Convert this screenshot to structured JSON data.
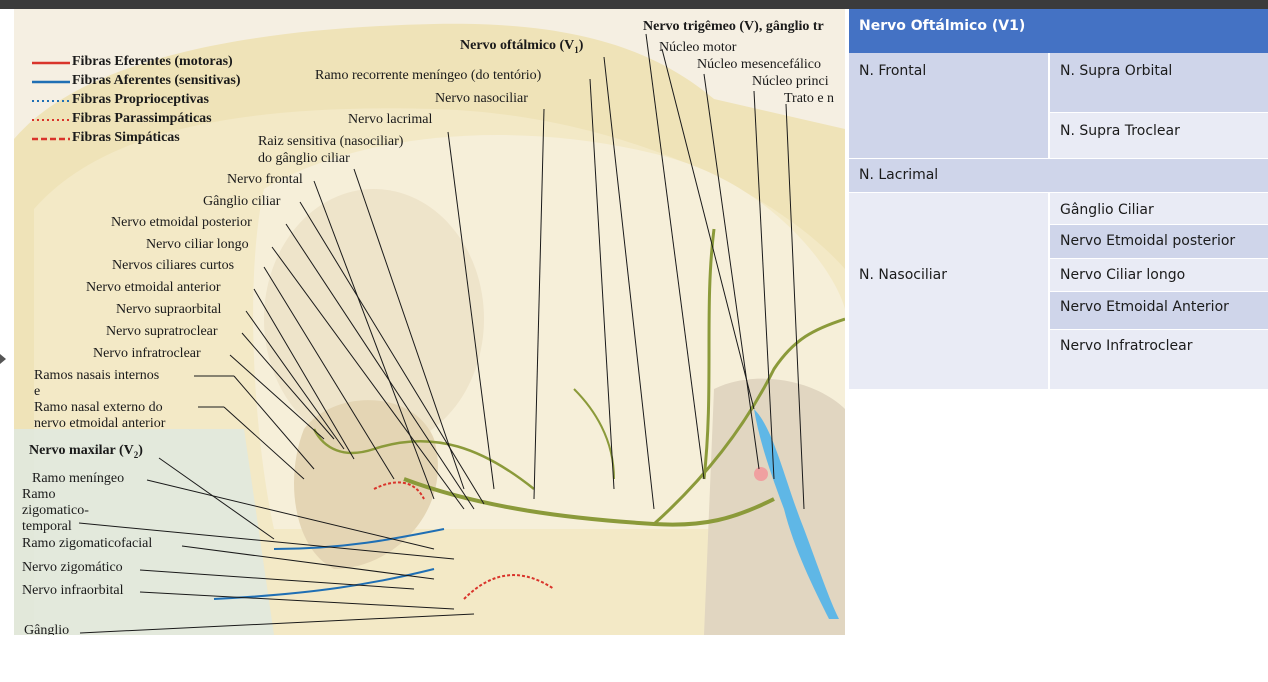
{
  "legend": [
    {
      "label": "Fibras Eferentes (motoras)",
      "color": "#d9342b",
      "style": "solid"
    },
    {
      "label": "Fibras Aferentes (sensitivas)",
      "color": "#1f6fb4",
      "style": "solid"
    },
    {
      "label": "Fibras Proprioceptivas",
      "color": "#1f6fb4",
      "style": "dotted"
    },
    {
      "label": "Fibras Parassimpáticas",
      "color": "#d9342b",
      "style": "dotted"
    },
    {
      "label": "Fibras Simpáticas",
      "color": "#d9342b",
      "style": "dashed"
    }
  ],
  "illustration": {
    "title_trigeminal": "Nervo trigêmeo (V), gânglio tr",
    "title_ophthalmic": "Nervo oftálmico (V",
    "title_ophthalmic_sub": "1",
    "title_ophthalmic_close": ")",
    "title_maxillary": "Nervo maxilar (V",
    "title_maxillary_sub": "2",
    "title_maxillary_close": ")",
    "labels": {
      "nucleo_motor": "Núcleo motor",
      "nucleo_mesencefalico": "Núcleo mesencefálico",
      "nucleo_principal": "Núcleo princi",
      "trato": "Trato e n",
      "ramo_recorrente": "Ramo recorrente meníngeo (do tentório)",
      "nervo_nasociliar": "Nervo nasociliar",
      "nervo_lacrimal": "Nervo lacrimal",
      "raiz_sensitiva_1": "Raiz sensitiva (nasociliar)",
      "raiz_sensitiva_2": "do gânglio ciliar",
      "nervo_frontal": "Nervo frontal",
      "ganglio_ciliar": "Gânglio ciliar",
      "etmoidal_posterior": "Nervo etmoidal posterior",
      "ciliar_longo": "Nervo ciliar longo",
      "ciliares_curtos": "Nervos ciliares curtos",
      "etmoidal_anterior": "Nervo etmoidal anterior",
      "supraorbital": "Nervo supraorbital",
      "supratroclear": "Nervo supratroclear",
      "infratroclear": "Nervo infratroclear",
      "ramos_nasais_1": "Ramos nasais internos",
      "ramos_nasais_2": "e",
      "ramos_nasais_3": "Ramo nasal externo do",
      "ramos_nasais_4": "nervo etmoidal anterior",
      "ramo_meningeo": "Ramo meníngeo",
      "ramo_zt_1": "Ramo",
      "ramo_zt_2": "zigomatico-",
      "ramo_zt_3": "temporal",
      "ramo_zf": "Ramo zigomaticofacial",
      "nervo_zigomatico": "Nervo zigomático",
      "nervo_infraorbital": "Nervo infraorbital",
      "ganglio": "Gânglio"
    }
  },
  "table": {
    "header": "Nervo Oftálmico (V1)",
    "frontal": "N. Frontal",
    "supra_orbital": "N. Supra Orbital",
    "supra_troclear": "N. Supra Troclear",
    "lacrimal": "N. Lacrimal",
    "nasociliar": "N. Nasociliar",
    "nasociliar_branches": [
      "Gânglio Ciliar",
      "Nervo Etmoidal posterior",
      "Nervo Ciliar longo",
      "Nervo Etmoidal Anterior",
      "Nervo Infratroclear"
    ]
  }
}
